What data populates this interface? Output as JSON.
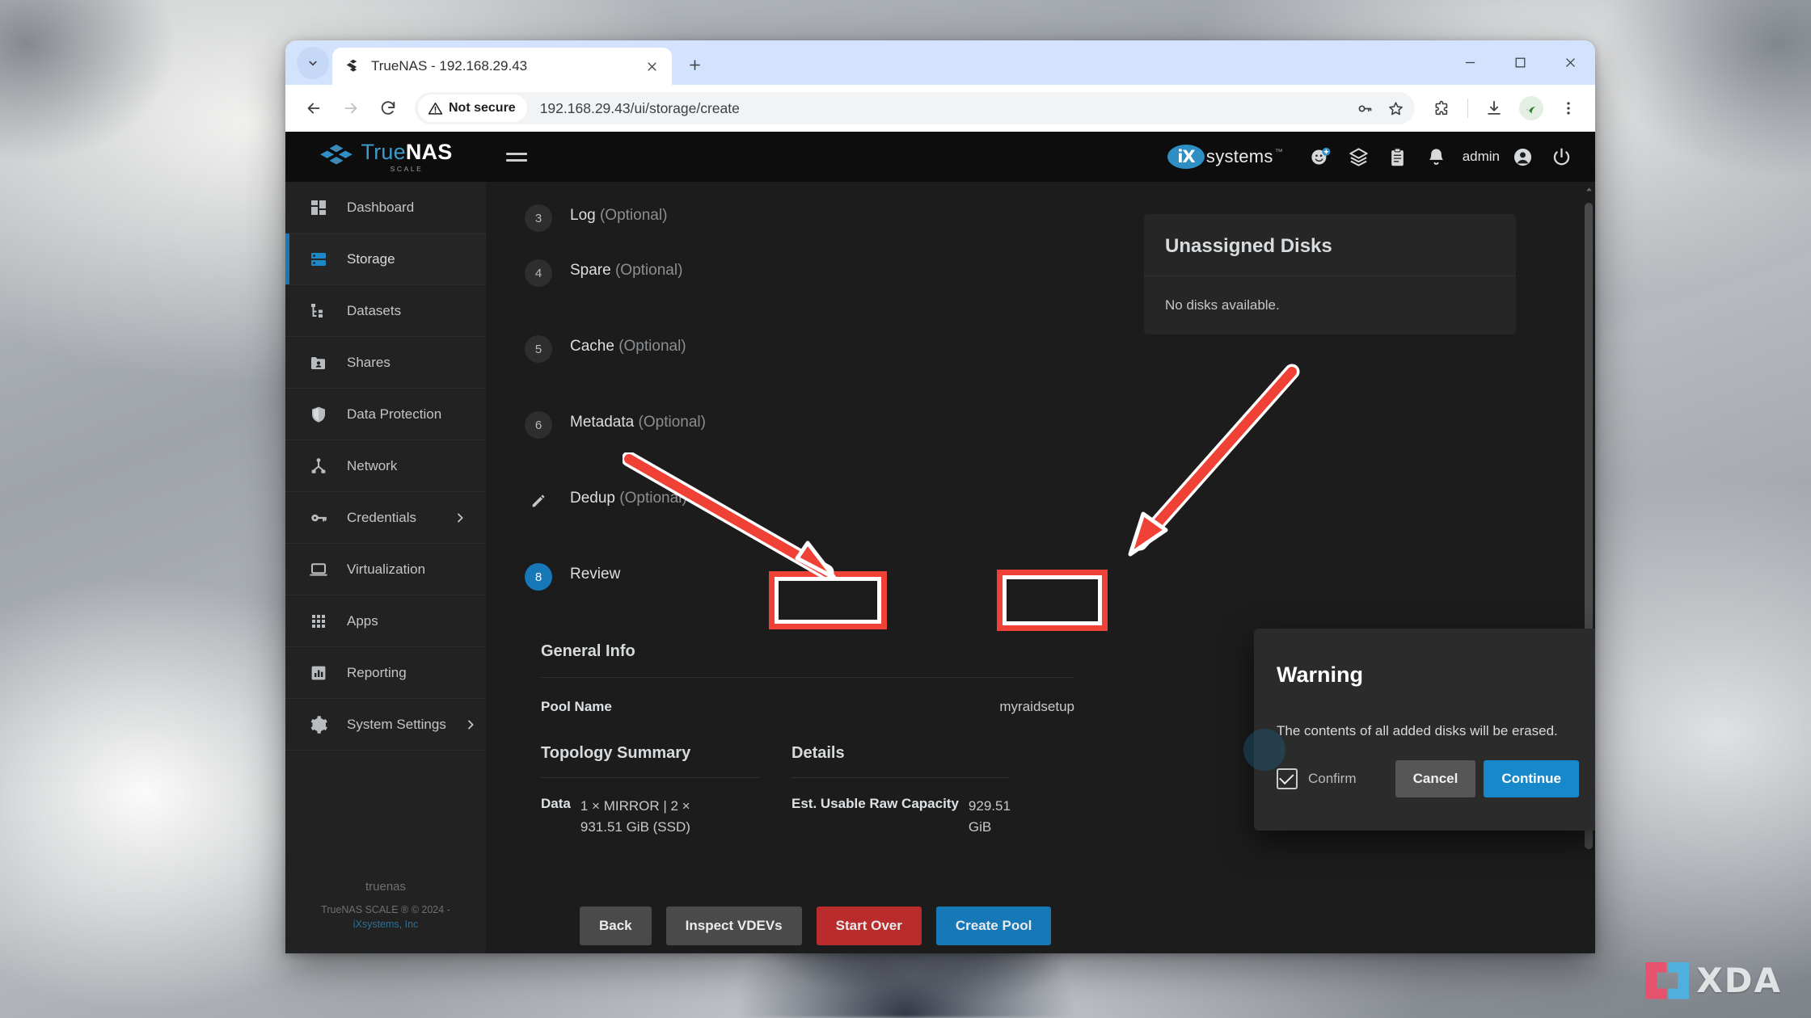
{
  "browser": {
    "tab": {
      "title": "TrueNAS - 192.168.29.43",
      "favicon_name": "truenas-favicon"
    },
    "newtab_label": "+",
    "address": {
      "security_label": "Not secure",
      "url": "192.168.29.43/ui/storage/create"
    },
    "window_controls": {
      "minimize": "minimize",
      "maximize": "maximize",
      "close": "close"
    }
  },
  "app": {
    "logo": {
      "primary": "True",
      "secondary": "NAS",
      "sub": "SCALE"
    },
    "brand": {
      "ix_mark": "iX",
      "ix_word": "systems",
      "tm": "™"
    },
    "user": "admin",
    "topbar_icons": [
      "add-user-icon",
      "layers-icon",
      "clipboard-icon",
      "bell-icon",
      "account-icon",
      "power-icon"
    ]
  },
  "sidebar": {
    "items": [
      {
        "label": "Dashboard",
        "icon": "dashboard-icon",
        "active": false,
        "chevron": false
      },
      {
        "label": "Storage",
        "icon": "storage-icon",
        "active": true,
        "chevron": false
      },
      {
        "label": "Datasets",
        "icon": "datasets-icon",
        "active": false,
        "chevron": false
      },
      {
        "label": "Shares",
        "icon": "shares-icon",
        "active": false,
        "chevron": false
      },
      {
        "label": "Data Protection",
        "icon": "shield-icon",
        "active": false,
        "chevron": false
      },
      {
        "label": "Network",
        "icon": "network-icon",
        "active": false,
        "chevron": false
      },
      {
        "label": "Credentials",
        "icon": "key-icon",
        "active": false,
        "chevron": true
      },
      {
        "label": "Virtualization",
        "icon": "laptop-icon",
        "active": false,
        "chevron": false
      },
      {
        "label": "Apps",
        "icon": "apps-grid-icon",
        "active": false,
        "chevron": false
      },
      {
        "label": "Reporting",
        "icon": "chart-icon",
        "active": false,
        "chevron": false
      },
      {
        "label": "System Settings",
        "icon": "gear-icon",
        "active": false,
        "chevron": true
      }
    ],
    "footer": {
      "hostname": "truenas",
      "copyright": "TrueNAS SCALE ® © 2024 -",
      "company": "iXsystems, Inc"
    }
  },
  "wizard": {
    "steps": [
      {
        "num": "3",
        "label": "Log",
        "optional": "(Optional)",
        "state": "pending"
      },
      {
        "num": "4",
        "label": "Spare",
        "optional": "(Optional)",
        "state": "pending"
      },
      {
        "num": "5",
        "label": "Cache",
        "optional": "(Optional)",
        "state": "pending"
      },
      {
        "num": "6",
        "label": "Metadata",
        "optional": "(Optional)",
        "state": "pending"
      },
      {
        "num": "",
        "label": "Dedup",
        "optional": "(Optional)",
        "state": "edit"
      },
      {
        "num": "8",
        "label": "Review",
        "optional": "",
        "state": "current"
      }
    ],
    "general_info": {
      "heading": "General Info",
      "pool_name_label": "Pool Name",
      "pool_name_value": "myraidsetup"
    },
    "topology": {
      "heading": "Topology Summary",
      "data_label": "Data",
      "data_value": "1 × MIRROR | 2 × 931.51 GiB (SSD)"
    },
    "details": {
      "heading": "Details",
      "capacity_label": "Est. Usable Raw Capacity",
      "capacity_value": "929.51 GiB"
    },
    "actions": {
      "back": "Back",
      "inspect": "Inspect VDEVs",
      "start_over": "Start Over",
      "create_pool": "Create Pool"
    }
  },
  "unassigned_disks": {
    "title": "Unassigned Disks",
    "empty_message": "No disks available."
  },
  "dialog": {
    "title": "Warning",
    "message": "The contents of all added disks will be erased.",
    "confirm_label": "Confirm",
    "confirm_checked": true,
    "cancel_label": "Cancel",
    "continue_label": "Continue"
  },
  "watermark": {
    "text": "XDA"
  },
  "colors": {
    "accent_blue": "#1778b8",
    "danger_red": "#ba2b2b",
    "annotation_red": "#ef4136",
    "sidebar_bg": "#222222",
    "content_bg": "#1c1c1c"
  }
}
